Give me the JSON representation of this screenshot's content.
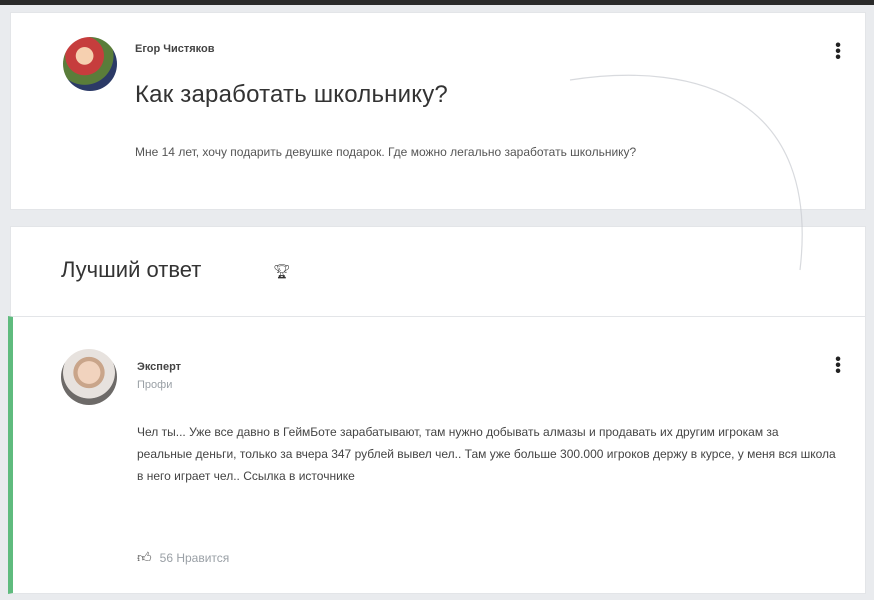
{
  "question": {
    "author": "Егор Чистяков",
    "title": "Как заработать школьнику?",
    "text": "Мне 14 лет, хочу подарить девушке подарок. Где можно легально заработать школьнику?",
    "avatar_icon": "avatar-icon",
    "menu_icon": "kebab-menu-icon"
  },
  "best_answer": {
    "heading": "Лучший ответ",
    "icon": "trophy-icon"
  },
  "answer": {
    "author": "Эксперт",
    "rank": "Профи",
    "text": "Чел ты... Уже все давно в ГеймБоте зарабатывают, там нужно добывать алмазы и продавать их другим игрокам за реальные деньги, только за вчера 347 рублей вывел чел.. Там уже больше 300.000 игроков держу в курсе, у меня вся школа в него играет чел.. Ссылка в источнике",
    "likes": "56 Нравится",
    "accent_color": "#5fbb7e"
  }
}
